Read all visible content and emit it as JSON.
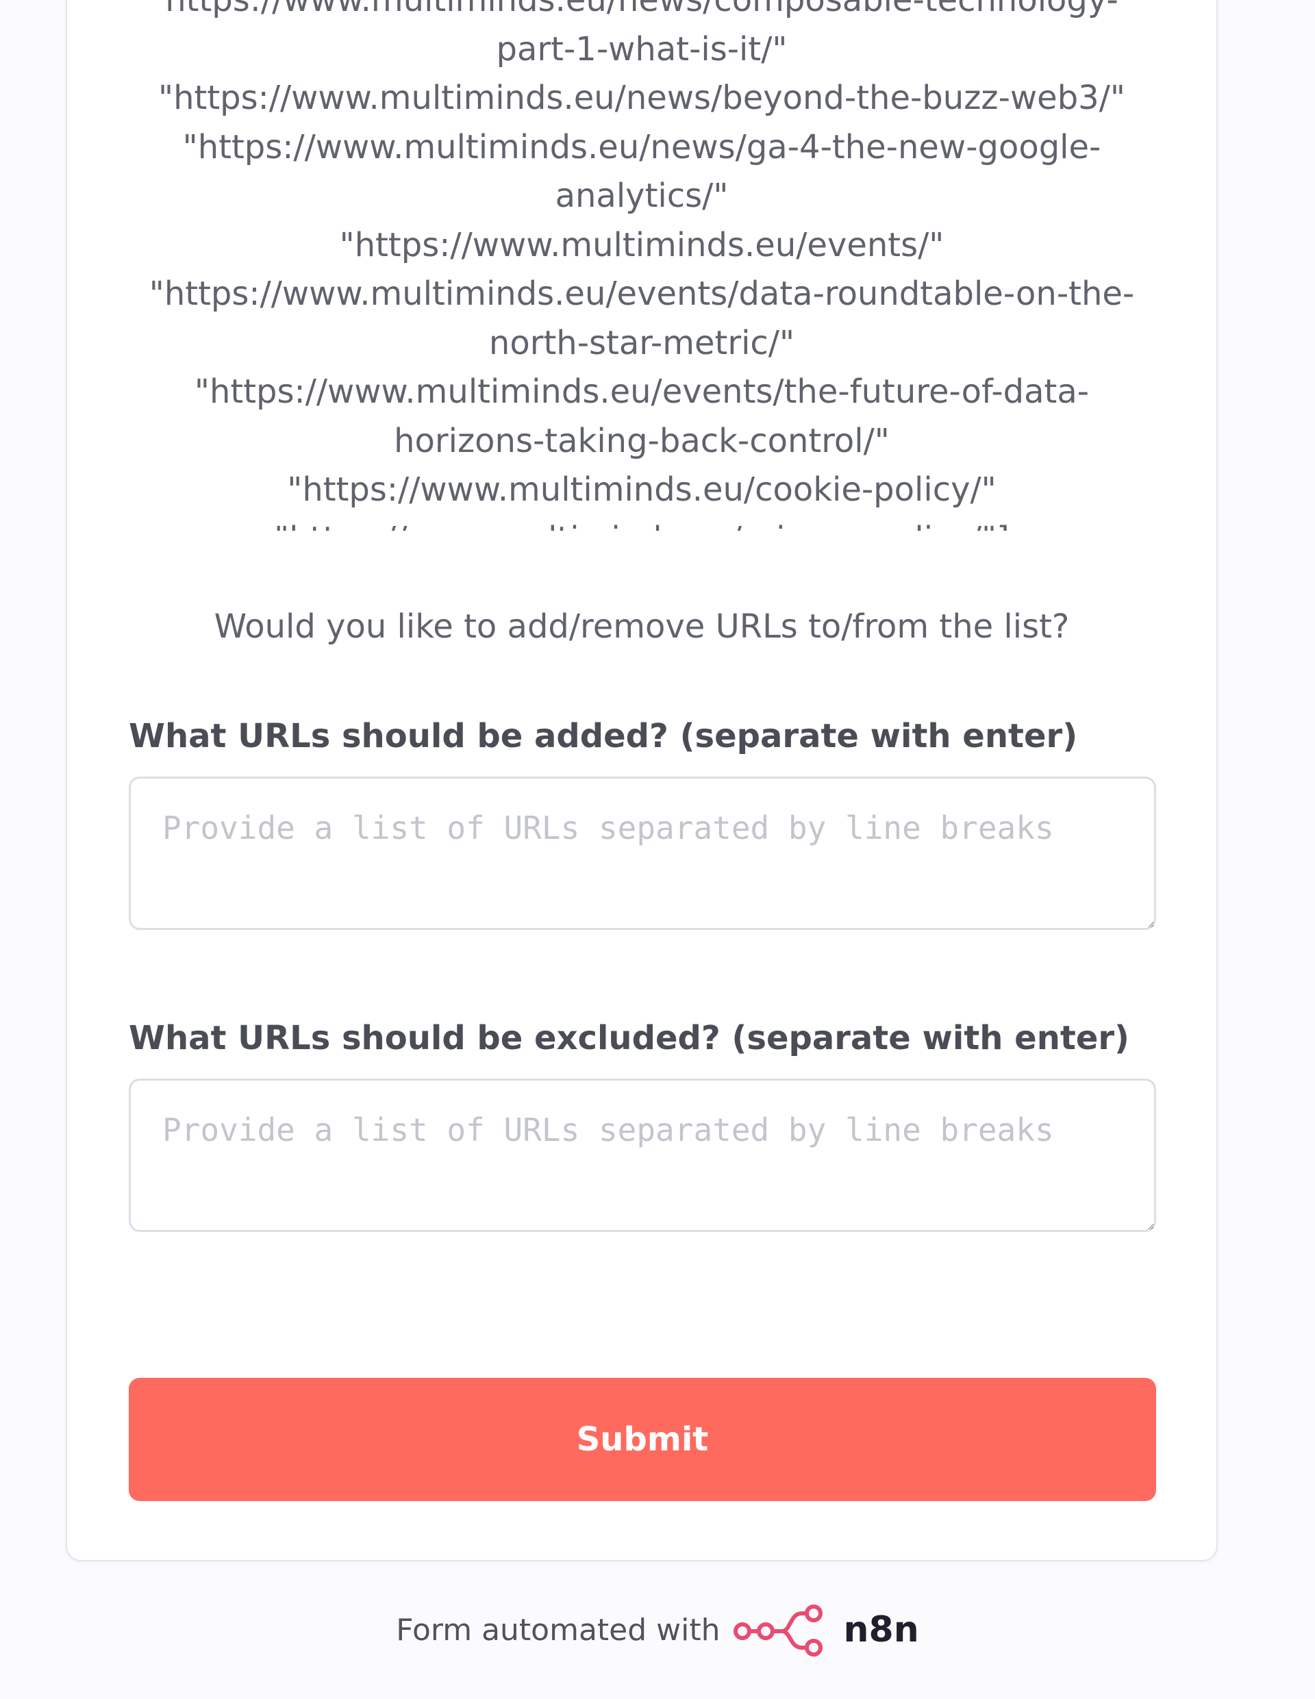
{
  "url_list": {
    "lines": [
      "https://www.multiminds.eu/news/composable-technology-",
      "part-1-what-is-it/\"",
      "\"https://www.multiminds.eu/news/beyond-the-buzz-web3/\"",
      "\"https://www.multiminds.eu/news/ga-4-the-new-google-",
      "analytics/\"",
      "\"https://www.multiminds.eu/events/\"",
      "\"https://www.multiminds.eu/events/data-roundtable-on-the-",
      "north-star-metric/\"",
      "\"https://www.multiminds.eu/events/the-future-of-data-",
      "horizons-taking-back-control/\"",
      "\"https://www.multiminds.eu/cookie-policy/\"",
      "\"https://www.multiminds.eu/privacy-policy/\"]"
    ]
  },
  "question": "Would you like to add/remove URLs to/from the list?",
  "fields": {
    "add": {
      "label": "What URLs should be added? (separate with enter)",
      "placeholder": "Provide a list of URLs separated by line breaks",
      "value": ""
    },
    "exclude": {
      "label": "What URLs should be excluded? (separate with enter)",
      "placeholder": "Provide a list of URLs separated by line breaks",
      "value": ""
    }
  },
  "submit_label": "Submit",
  "footer": {
    "text": "Form automated with",
    "brand": "n8n",
    "logo_icon": "n8n-logo-icon",
    "brand_color": "#ea4b71"
  },
  "colors": {
    "submit_bg": "#ff6a5e",
    "page_bg": "#fbfbfd"
  }
}
